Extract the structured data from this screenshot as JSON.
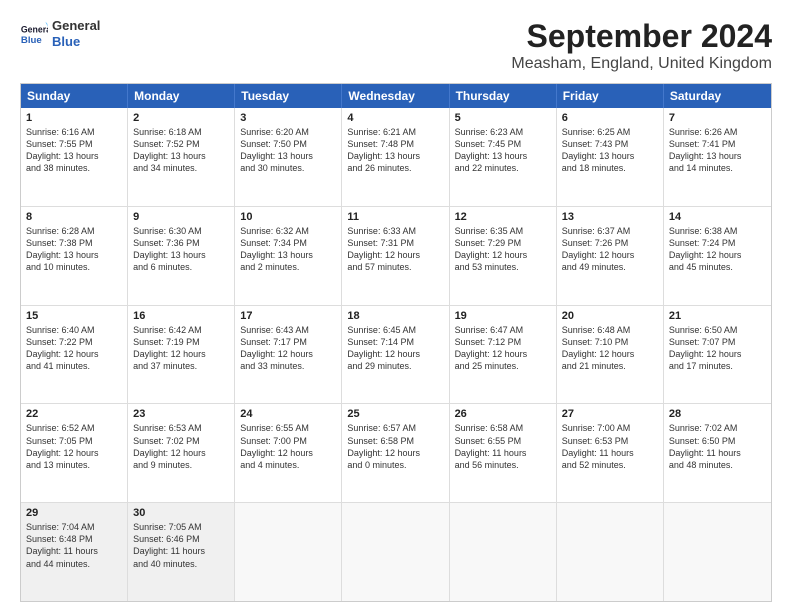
{
  "header": {
    "logo_general": "General",
    "logo_blue": "Blue",
    "title": "September 2024",
    "subtitle": "Measham, England, United Kingdom"
  },
  "days": [
    "Sunday",
    "Monday",
    "Tuesday",
    "Wednesday",
    "Thursday",
    "Friday",
    "Saturday"
  ],
  "weeks": [
    [
      {
        "day": "1",
        "lines": [
          "Sunrise: 6:16 AM",
          "Sunset: 7:55 PM",
          "Daylight: 13 hours",
          "and 38 minutes."
        ]
      },
      {
        "day": "2",
        "lines": [
          "Sunrise: 6:18 AM",
          "Sunset: 7:52 PM",
          "Daylight: 13 hours",
          "and 34 minutes."
        ]
      },
      {
        "day": "3",
        "lines": [
          "Sunrise: 6:20 AM",
          "Sunset: 7:50 PM",
          "Daylight: 13 hours",
          "and 30 minutes."
        ]
      },
      {
        "day": "4",
        "lines": [
          "Sunrise: 6:21 AM",
          "Sunset: 7:48 PM",
          "Daylight: 13 hours",
          "and 26 minutes."
        ]
      },
      {
        "day": "5",
        "lines": [
          "Sunrise: 6:23 AM",
          "Sunset: 7:45 PM",
          "Daylight: 13 hours",
          "and 22 minutes."
        ]
      },
      {
        "day": "6",
        "lines": [
          "Sunrise: 6:25 AM",
          "Sunset: 7:43 PM",
          "Daylight: 13 hours",
          "and 18 minutes."
        ]
      },
      {
        "day": "7",
        "lines": [
          "Sunrise: 6:26 AM",
          "Sunset: 7:41 PM",
          "Daylight: 13 hours",
          "and 14 minutes."
        ]
      }
    ],
    [
      {
        "day": "8",
        "lines": [
          "Sunrise: 6:28 AM",
          "Sunset: 7:38 PM",
          "Daylight: 13 hours",
          "and 10 minutes."
        ]
      },
      {
        "day": "9",
        "lines": [
          "Sunrise: 6:30 AM",
          "Sunset: 7:36 PM",
          "Daylight: 13 hours",
          "and 6 minutes."
        ]
      },
      {
        "day": "10",
        "lines": [
          "Sunrise: 6:32 AM",
          "Sunset: 7:34 PM",
          "Daylight: 13 hours",
          "and 2 minutes."
        ]
      },
      {
        "day": "11",
        "lines": [
          "Sunrise: 6:33 AM",
          "Sunset: 7:31 PM",
          "Daylight: 12 hours",
          "and 57 minutes."
        ]
      },
      {
        "day": "12",
        "lines": [
          "Sunrise: 6:35 AM",
          "Sunset: 7:29 PM",
          "Daylight: 12 hours",
          "and 53 minutes."
        ]
      },
      {
        "day": "13",
        "lines": [
          "Sunrise: 6:37 AM",
          "Sunset: 7:26 PM",
          "Daylight: 12 hours",
          "and 49 minutes."
        ]
      },
      {
        "day": "14",
        "lines": [
          "Sunrise: 6:38 AM",
          "Sunset: 7:24 PM",
          "Daylight: 12 hours",
          "and 45 minutes."
        ]
      }
    ],
    [
      {
        "day": "15",
        "lines": [
          "Sunrise: 6:40 AM",
          "Sunset: 7:22 PM",
          "Daylight: 12 hours",
          "and 41 minutes."
        ]
      },
      {
        "day": "16",
        "lines": [
          "Sunrise: 6:42 AM",
          "Sunset: 7:19 PM",
          "Daylight: 12 hours",
          "and 37 minutes."
        ]
      },
      {
        "day": "17",
        "lines": [
          "Sunrise: 6:43 AM",
          "Sunset: 7:17 PM",
          "Daylight: 12 hours",
          "and 33 minutes."
        ]
      },
      {
        "day": "18",
        "lines": [
          "Sunrise: 6:45 AM",
          "Sunset: 7:14 PM",
          "Daylight: 12 hours",
          "and 29 minutes."
        ]
      },
      {
        "day": "19",
        "lines": [
          "Sunrise: 6:47 AM",
          "Sunset: 7:12 PM",
          "Daylight: 12 hours",
          "and 25 minutes."
        ]
      },
      {
        "day": "20",
        "lines": [
          "Sunrise: 6:48 AM",
          "Sunset: 7:10 PM",
          "Daylight: 12 hours",
          "and 21 minutes."
        ]
      },
      {
        "day": "21",
        "lines": [
          "Sunrise: 6:50 AM",
          "Sunset: 7:07 PM",
          "Daylight: 12 hours",
          "and 17 minutes."
        ]
      }
    ],
    [
      {
        "day": "22",
        "lines": [
          "Sunrise: 6:52 AM",
          "Sunset: 7:05 PM",
          "Daylight: 12 hours",
          "and 13 minutes."
        ]
      },
      {
        "day": "23",
        "lines": [
          "Sunrise: 6:53 AM",
          "Sunset: 7:02 PM",
          "Daylight: 12 hours",
          "and 9 minutes."
        ]
      },
      {
        "day": "24",
        "lines": [
          "Sunrise: 6:55 AM",
          "Sunset: 7:00 PM",
          "Daylight: 12 hours",
          "and 4 minutes."
        ]
      },
      {
        "day": "25",
        "lines": [
          "Sunrise: 6:57 AM",
          "Sunset: 6:58 PM",
          "Daylight: 12 hours",
          "and 0 minutes."
        ]
      },
      {
        "day": "26",
        "lines": [
          "Sunrise: 6:58 AM",
          "Sunset: 6:55 PM",
          "Daylight: 11 hours",
          "and 56 minutes."
        ]
      },
      {
        "day": "27",
        "lines": [
          "Sunrise: 7:00 AM",
          "Sunset: 6:53 PM",
          "Daylight: 11 hours",
          "and 52 minutes."
        ]
      },
      {
        "day": "28",
        "lines": [
          "Sunrise: 7:02 AM",
          "Sunset: 6:50 PM",
          "Daylight: 11 hours",
          "and 48 minutes."
        ]
      }
    ],
    [
      {
        "day": "29",
        "lines": [
          "Sunrise: 7:04 AM",
          "Sunset: 6:48 PM",
          "Daylight: 11 hours",
          "and 44 minutes."
        ]
      },
      {
        "day": "30",
        "lines": [
          "Sunrise: 7:05 AM",
          "Sunset: 6:46 PM",
          "Daylight: 11 hours",
          "and 40 minutes."
        ]
      },
      {
        "day": "",
        "lines": []
      },
      {
        "day": "",
        "lines": []
      },
      {
        "day": "",
        "lines": []
      },
      {
        "day": "",
        "lines": []
      },
      {
        "day": "",
        "lines": []
      }
    ]
  ]
}
